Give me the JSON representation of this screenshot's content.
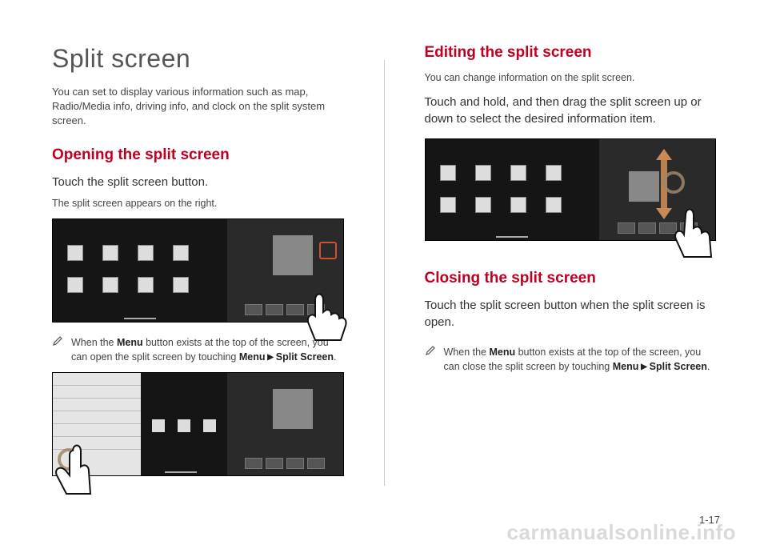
{
  "left": {
    "title": "Split screen",
    "intro": "You can set to display various information such as map, Radio/Media info, driving info, and clock on the split system screen.",
    "section1": {
      "heading": "Opening the split screen",
      "sub": "Touch the split screen button.",
      "small": "The split screen appears on the right.",
      "note_prefix": "When the ",
      "note_menu": "Menu",
      "note_mid1": " button exists at the top of the screen, you can open the split screen by touching ",
      "note_menu2": "Menu",
      "note_arrow": " ▶ ",
      "note_split": "Split Screen",
      "note_end": "."
    }
  },
  "right": {
    "section2": {
      "heading": "Editing the split screen",
      "small": "You can change information on the split screen.",
      "sub": "Touch and hold, and then drag the split screen up or down to select the desired information item."
    },
    "section3": {
      "heading": "Closing the split screen",
      "sub": "Touch the split screen button when the split screen is open.",
      "note_prefix": "When the ",
      "note_menu": "Menu",
      "note_mid1": " button exists at the top of the screen, you can close the split screen by touching ",
      "note_menu2": "Menu",
      "note_arrow": " ▶ ",
      "note_split": "Split Screen",
      "note_end": "."
    }
  },
  "page_num": "1-17",
  "watermark": "carmanualsonline.info"
}
